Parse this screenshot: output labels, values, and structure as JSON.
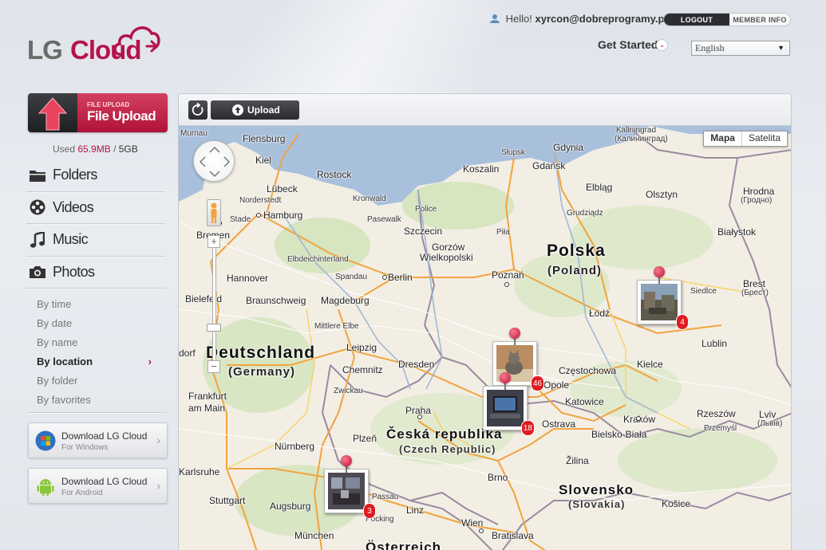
{
  "header": {
    "logo_lg": "LG",
    "logo_cloud": "Cloud",
    "hello_prefix": "Hello!",
    "user_email": "xyrcon@dobreprogramy.pl",
    "logout_label": "LOGOUT",
    "member_info_label": "MEMBER INFO",
    "get_started_label": "Get Started",
    "language_selected": "English",
    "accent_color": "#b5134b"
  },
  "sidebar": {
    "upload_small": "FILE UPLOAD",
    "upload_big": "File Upload",
    "usage_prefix": "Used",
    "usage_used": "65.9MB",
    "usage_separator": "/",
    "usage_total": "5GB",
    "nav": [
      {
        "label": "Folders",
        "icon": "folder-icon"
      },
      {
        "label": "Videos",
        "icon": "film-reel-icon"
      },
      {
        "label": "Music",
        "icon": "music-note-icon"
      },
      {
        "label": "Photos",
        "icon": "camera-icon"
      }
    ],
    "photo_filters": [
      {
        "label": "By time"
      },
      {
        "label": "By date"
      },
      {
        "label": "By name"
      },
      {
        "label": "By location",
        "active": true
      },
      {
        "label": "By folder"
      },
      {
        "label": "By favorites"
      }
    ],
    "download_windows": {
      "title": "Download LG Cloud",
      "subtitle": "For Windows",
      "icon": "windows-logo-icon"
    },
    "download_android": {
      "title": "Download LG Cloud",
      "subtitle": "For Android",
      "icon": "android-robot-icon"
    }
  },
  "toolbar": {
    "refresh_icon": "refresh-icon",
    "upload_label": "Upload"
  },
  "map": {
    "map_type_map": "Mapa",
    "map_type_satellite": "Satelita",
    "labels": {
      "kaliningrad": "Kaliningrad",
      "kaliningrad_ru": "(Калининград)",
      "gdynia": "Gdynia",
      "slupsk": "Słupsk",
      "gdansk": "Gdańsk",
      "koszalin": "Koszalin",
      "elblag": "Elbląg",
      "olsztyn": "Olsztyn",
      "hrodna": "Hrodna",
      "hrodna_ru": "(Гродно)",
      "flensburg": "Flensburg",
      "kiel": "Kiel",
      "rostock": "Rostock",
      "lubeck": "Lübeck",
      "norderstedt": "Norderstedt",
      "kronwald": "Kronwald",
      "hamburg": "Hamburg",
      "stade": "Stade",
      "pasewalk": "Pasewalk",
      "police": "Police",
      "szczecin": "Szczecin",
      "grudziadz": "Grudziądz",
      "pila": "Piła",
      "gorzow": "Gorzów",
      "wielkopolski": "Wielkopolski",
      "bialystok": "Białystok",
      "bremen": "Bremen",
      "elbdeich": "Elbdeichinterland",
      "polska": "Polska",
      "poland": "(Poland)",
      "hannover": "Hannover",
      "spandau": "Spandau",
      "berlin": "Berlin",
      "poznan": "Poznań",
      "brest": "Brest",
      "brest_ru": "(Брест)",
      "siedlce": "Siedlce",
      "braunschweig": "Braunschweig",
      "magdeburg": "Magdeburg",
      "bielefeld": "Bielefeld",
      "mittlere_elbe": "Mittlere Elbe",
      "lodz": "Łódź",
      "deutschland": "Deutschland",
      "germany": "(Germany)",
      "leipzig": "Leipzig",
      "lublin": "Lublin",
      "dorf": "dorf",
      "chemnitz": "Chemnitz",
      "dresden": "Dresden",
      "czestochowa": "Częstochowa",
      "kielce": "Kielce",
      "zwickau": "Zwickau",
      "opole": "Opole",
      "katowice": "Katowice",
      "frankfurt": "Frankfurt",
      "am_main": "am Main",
      "praha": "Praha",
      "krakow": "Kraków",
      "rzeszow": "Rzeszów",
      "lviv": "Lviv",
      "lviv_ru": "(Львів)",
      "ostrava": "Ostrava",
      "bielsko": "Bielsko-Biała",
      "przemysl": "Przemyśl",
      "plzen": "Plzeň",
      "ceska": "Česká republika",
      "czech": "(Czech Republic)",
      "nurnberg": "Nürnberg",
      "karlsruhe": "Karlsruhe",
      "zilina": "Žilina",
      "brno": "Brno",
      "slovensko": "Slovensko",
      "slovakia": "(Slovakia)",
      "kosice": "Košice",
      "stuttgart": "Stuttgart",
      "augsburg": "Augsburg",
      "passau": "Passau",
      "linz": "Linz",
      "pocking": "Pocking",
      "wien": "Wien",
      "bratislava": "Bratislava",
      "munchen": "München",
      "osterreich": "Österreich",
      "murnau": "Murnau"
    },
    "markers": [
      {
        "count": "4",
        "photo": "street-photo"
      },
      {
        "count": "46",
        "photo": "cat-photo"
      },
      {
        "count": "18",
        "photo": "laptop-photo"
      },
      {
        "count": "3",
        "photo": "room-photo"
      }
    ]
  }
}
